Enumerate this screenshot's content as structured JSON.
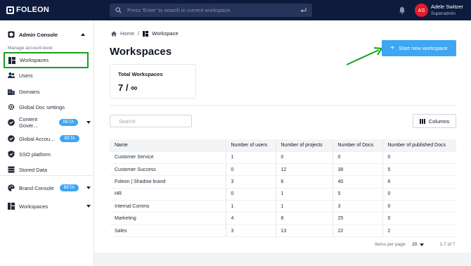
{
  "topbar": {
    "logo": "FOLEON",
    "search_placeholder": "Press 'Enter' to search in current workspace.",
    "user_initials": "AS",
    "user_name": "Adele Switzer",
    "user_role": "Superadmin"
  },
  "sidebar": {
    "heading": "Admin Console",
    "subheading": "Manage account-level",
    "items": [
      {
        "label": "Workspaces",
        "icon": "workspace-icon"
      },
      {
        "label": "Users",
        "icon": "users-icon"
      },
      {
        "label": "Domains",
        "icon": "domains-icon"
      },
      {
        "label": "Global Doc settings",
        "icon": "gear-icon"
      },
      {
        "label": "Content Gover...",
        "icon": "check-badge-icon",
        "badge": "BETA"
      },
      {
        "label": "Global Accou...",
        "icon": "check-badge-icon",
        "badge": "BETA"
      },
      {
        "label": "SSO platform",
        "icon": "shield-icon"
      },
      {
        "label": "Stored Data",
        "icon": "database-icon"
      }
    ],
    "brand_console": {
      "label": "Brand Console",
      "badge": "BETA"
    },
    "workspaces_bottom": "Workspaces"
  },
  "breadcrumb": {
    "home": "Home",
    "separator": "/",
    "current": "Workspace"
  },
  "page_title": "Workspaces",
  "new_workspace_button": "Start new workspace",
  "stats": {
    "label": "Total Workspaces",
    "value": "7 / ∞"
  },
  "table_search_placeholder": "Search",
  "columns_button": "Columns",
  "table": {
    "headers": [
      "Name",
      "Number of users",
      "Number of projects",
      "Number of Docs",
      "Number of published Docs"
    ],
    "rows": [
      [
        "Customer Service",
        "1",
        "0",
        "0",
        "0"
      ],
      [
        "Customer Success",
        "0",
        "12",
        "38",
        "5"
      ],
      [
        "Foleon | Shadow brand",
        "3",
        "6",
        "40",
        "6"
      ],
      [
        "HR",
        "0",
        "1",
        "5",
        "0"
      ],
      [
        "Internal Comms",
        "1",
        "1",
        "3",
        "0"
      ],
      [
        "Marketing",
        "4",
        "8",
        "25",
        "0"
      ],
      [
        "Sales",
        "3",
        "13",
        "22",
        "2"
      ]
    ]
  },
  "pagination": {
    "items_per_page_label": "Items per page:",
    "items_per_page": "20",
    "range": "1-7 of 7"
  },
  "colors": {
    "topbar": "#0f1b3d",
    "accent": "#3ea6f2",
    "highlight": "#16a21a",
    "avatar": "#e11d2a"
  }
}
